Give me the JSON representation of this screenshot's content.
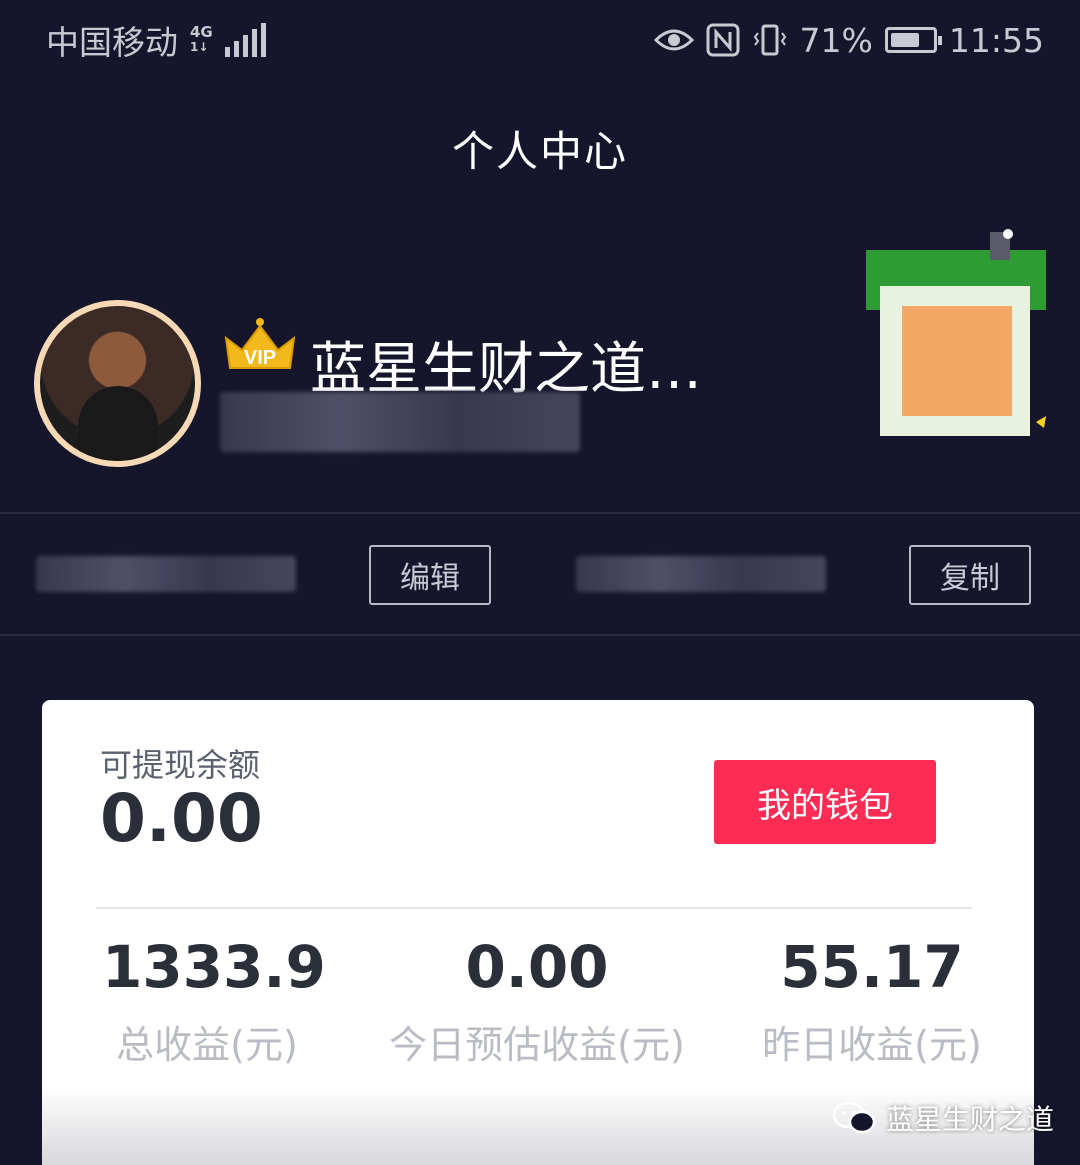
{
  "status_bar": {
    "carrier": "中国移动",
    "network": "4G",
    "battery_percent": "71%",
    "battery_level": 0.71,
    "time": "11:55"
  },
  "header": {
    "title": "个人中心"
  },
  "profile": {
    "badge": "VIP",
    "username": "蓝星生财之道…"
  },
  "actions": {
    "edit_label": "编辑",
    "copy_label": "复制"
  },
  "earnings": {
    "balance_label": "可提现余额",
    "balance_value": "0.00",
    "wallet_button": "我的钱包",
    "stats": [
      {
        "value": "1333.9",
        "label": "总收益(元)"
      },
      {
        "value": "0.00",
        "label": "今日预估收益(元)"
      },
      {
        "value": "55.17",
        "label": "昨日收益(元)"
      }
    ]
  },
  "watermark": {
    "text": "蓝星生财之道"
  },
  "colors": {
    "background": "#15152b",
    "accent": "#fe2c55",
    "card": "#ffffff"
  }
}
